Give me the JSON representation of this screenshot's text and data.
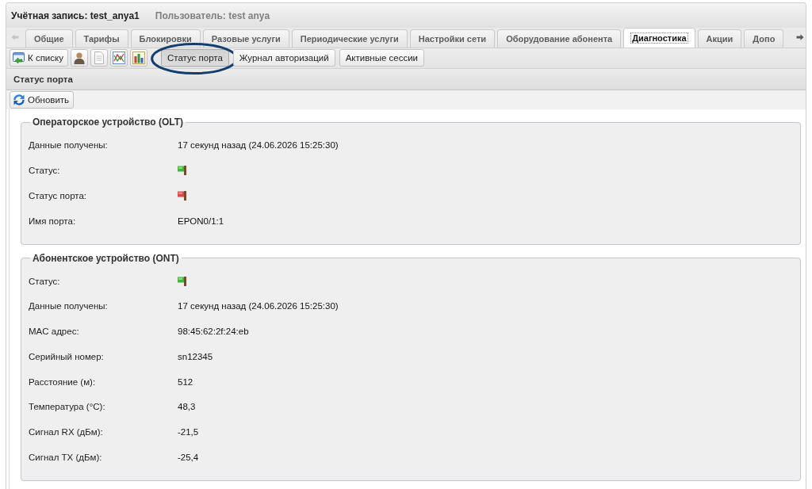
{
  "header": {
    "account": "Учётная запись: test_anya1",
    "user": "Пользователь: test anya"
  },
  "tabs": [
    {
      "label": "Общие",
      "selected": false
    },
    {
      "label": "Тарифы",
      "selected": false
    },
    {
      "label": "Блокировки",
      "selected": false
    },
    {
      "label": "Разовые услуги",
      "selected": false
    },
    {
      "label": "Периодические услуги",
      "selected": false
    },
    {
      "label": "Настройки сети",
      "selected": false
    },
    {
      "label": "Оборудование абонента",
      "selected": false
    },
    {
      "label": "Диагностика",
      "selected": true
    },
    {
      "label": "Акции",
      "selected": false
    },
    {
      "label": "Допо",
      "selected": false
    }
  ],
  "toolbar": {
    "back_button": "К списку",
    "views": [
      {
        "label": "Статус порта",
        "selected": true,
        "circled": true
      },
      {
        "label": "Журнал авторизаций",
        "selected": false,
        "circled": false
      },
      {
        "label": "Активные сессии",
        "selected": false,
        "circled": false
      }
    ]
  },
  "panel": {
    "title": "Статус порта",
    "refresh_button": "Обновить"
  },
  "sections": [
    {
      "legend": "Операторское устройство (OLT)",
      "rows": [
        {
          "label": "Данные получены:",
          "kind": "text",
          "value": "17 секунд назад (24.06.2026 15:25:30)"
        },
        {
          "label": "Статус:",
          "kind": "flag",
          "on": true
        },
        {
          "label": "Статус порта:",
          "kind": "flag",
          "on": false
        },
        {
          "label": "Имя порта:",
          "kind": "text",
          "value": "EPON0/1:1"
        }
      ]
    },
    {
      "legend": "Абонентское устройство (ONT)",
      "rows": [
        {
          "label": "Статус:",
          "kind": "flag",
          "on": true
        },
        {
          "label": "Данные получены:",
          "kind": "text",
          "value": "17 секунд назад (24.06.2026 15:25:30)"
        },
        {
          "label": "MAC адрес:",
          "kind": "text",
          "value": "98:45:62:2f:24:eb"
        },
        {
          "label": "Серийный номер:",
          "kind": "text",
          "value": "sn12345"
        },
        {
          "label": "Расстояние (м):",
          "kind": "text",
          "value": "512"
        },
        {
          "label": "Температура (°C):",
          "kind": "text",
          "value": "48,3"
        },
        {
          "label": "Сигнал RX (дБм):",
          "kind": "text",
          "value": "-21,5"
        },
        {
          "label": "Сигнал TX (дБм):",
          "kind": "text",
          "value": "-25,4"
        }
      ]
    }
  ]
}
